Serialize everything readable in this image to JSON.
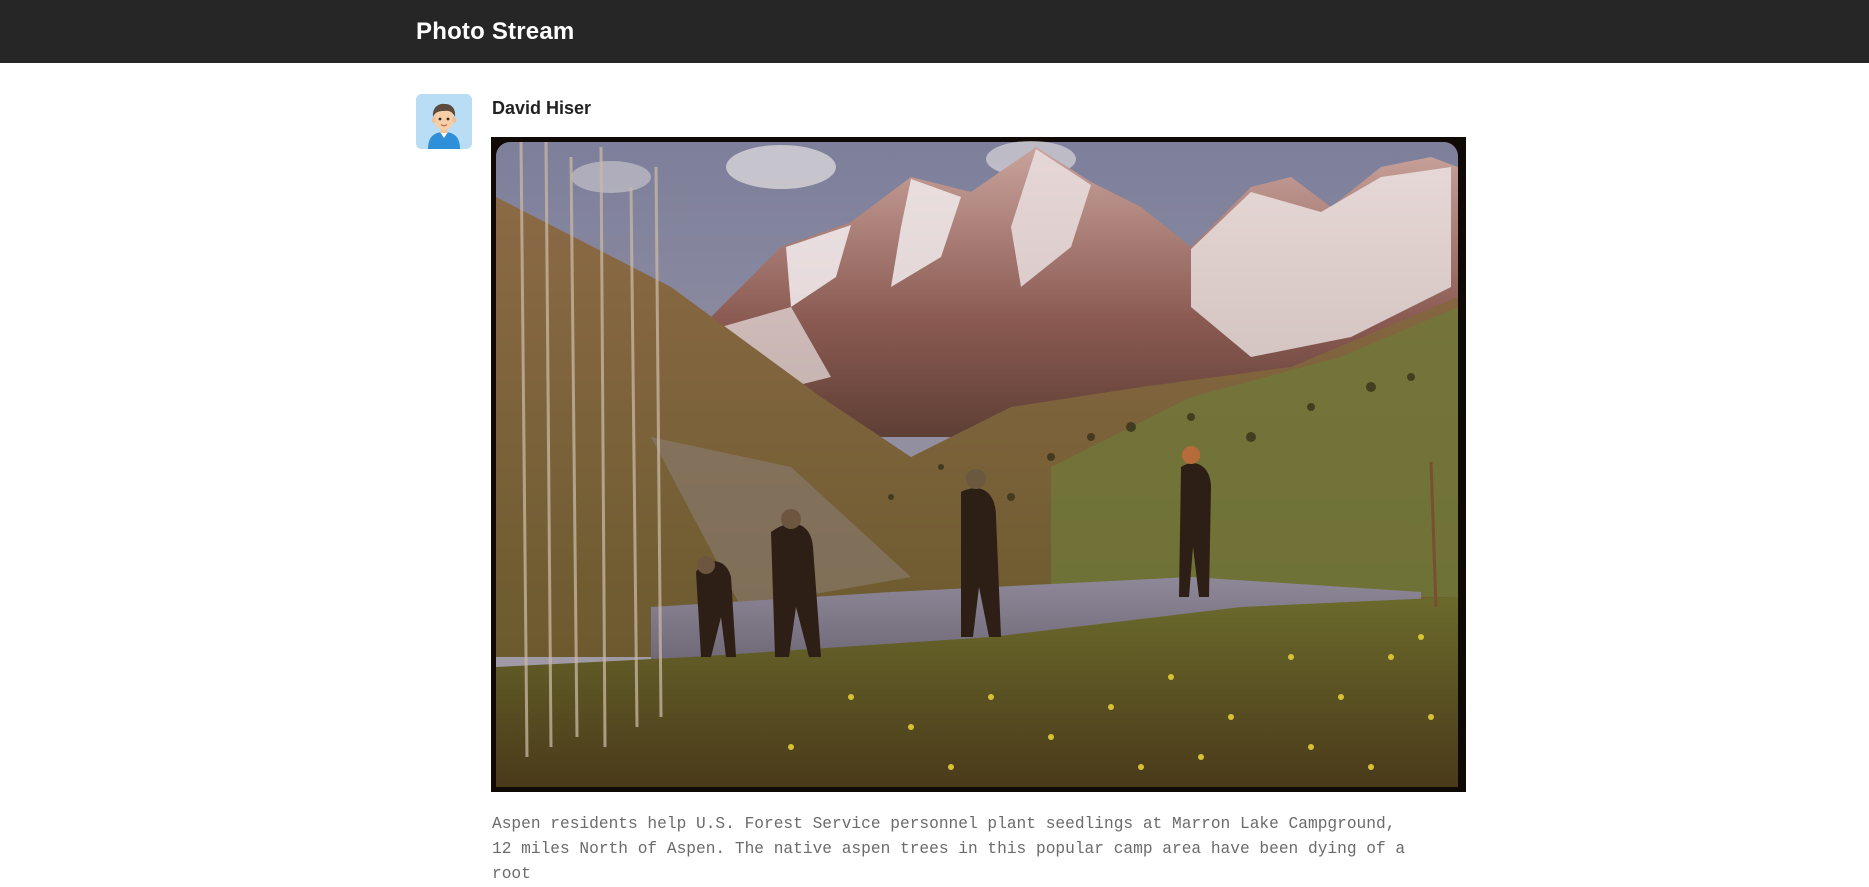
{
  "header": {
    "title": "Photo Stream"
  },
  "post": {
    "author": "David Hiser",
    "avatar_icon": "person-avatar-icon",
    "photo_description": "Aspen residents plant seedlings in a mountain meadow below snowy peaks",
    "caption": "Aspen residents help U.S. Forest Service personnel plant seedlings at Marron Lake Campground, 12 miles North of Aspen. The native aspen trees in this popular camp area have been dying of a root"
  },
  "colors": {
    "header_bg": "#262626",
    "header_text": "#ffffff",
    "author_text": "#222222",
    "caption_text": "#6b6b6b",
    "avatar_bg": "#b8ddf4"
  }
}
